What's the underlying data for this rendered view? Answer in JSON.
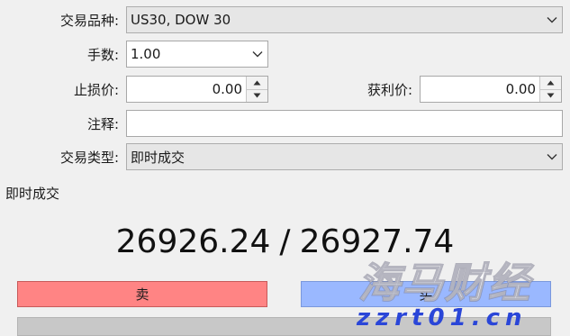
{
  "form": {
    "symbol": {
      "label": "交易品种:",
      "value": "US30, DOW 30"
    },
    "volume": {
      "label": "手数:",
      "value": "1.00"
    },
    "stop_loss": {
      "label": "止损价:",
      "value": "0.00"
    },
    "take_profit": {
      "label": "获利价:",
      "value": "0.00"
    },
    "comment": {
      "label": "注释:",
      "value": ""
    },
    "order_type": {
      "label": "交易类型:",
      "value": "即时成交"
    }
  },
  "execution": {
    "section_title": "即时成交",
    "bid": "26926.24",
    "separator": "/",
    "ask": "26927.74"
  },
  "buttons": {
    "sell_label": "卖",
    "buy_label": "买"
  },
  "watermark": {
    "brand": "海马财经",
    "site": "zzrt01.cn"
  },
  "colors": {
    "sell": "#ff8484",
    "buy": "#9ab8ff",
    "watermark_site": "#2a46d8"
  },
  "icons": {
    "dropdown": "chevron-down-icon",
    "spin_up": "arrow-up-icon",
    "spin_down": "arrow-down-icon"
  }
}
